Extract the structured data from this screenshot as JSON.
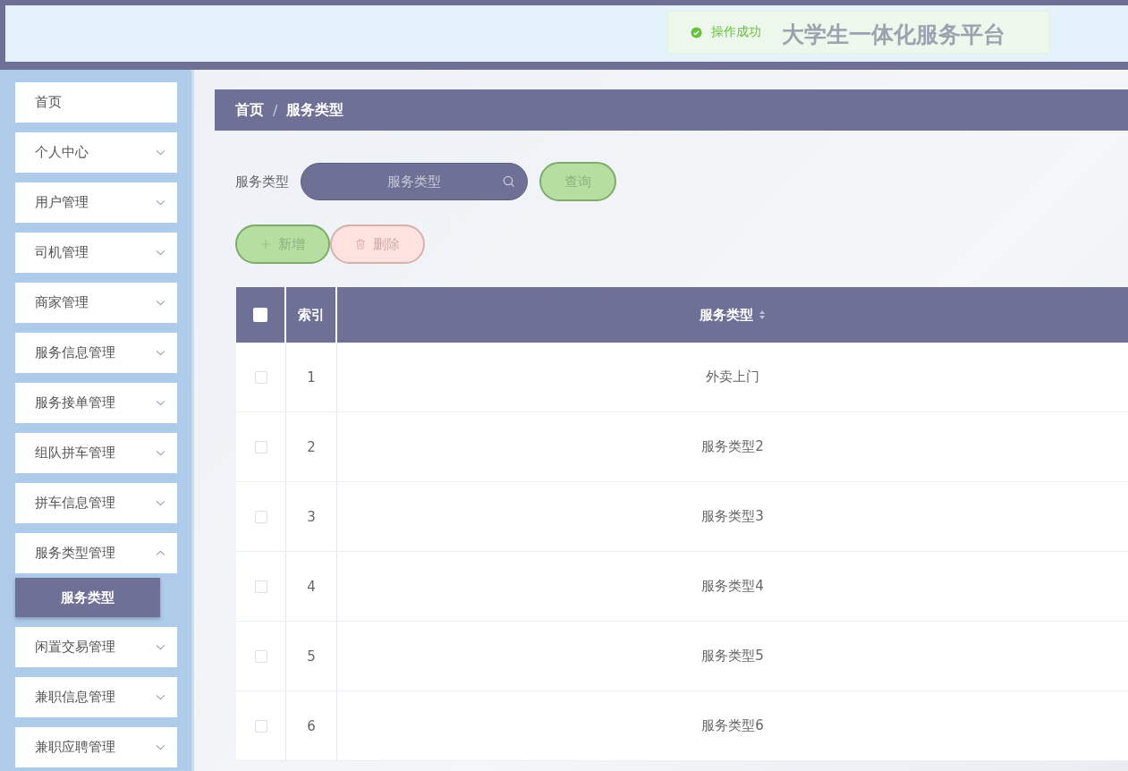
{
  "header": {
    "title": "大学生一体化服务平台",
    "toast": {
      "kind": "success",
      "message": "操作成功"
    }
  },
  "sidebar": {
    "items": [
      {
        "label": "首页",
        "kind": "link",
        "selected": false
      },
      {
        "label": "个人中心",
        "kind": "submenu",
        "expanded": false
      },
      {
        "label": "用户管理",
        "kind": "submenu",
        "expanded": false
      },
      {
        "label": "司机管理",
        "kind": "submenu",
        "expanded": false
      },
      {
        "label": "商家管理",
        "kind": "submenu",
        "expanded": false
      },
      {
        "label": "服务信息管理",
        "kind": "submenu",
        "expanded": false
      },
      {
        "label": "服务接单管理",
        "kind": "submenu",
        "expanded": false
      },
      {
        "label": "组队拼车管理",
        "kind": "submenu",
        "expanded": false
      },
      {
        "label": "拼车信息管理",
        "kind": "submenu",
        "expanded": false
      },
      {
        "label": "服务类型管理",
        "kind": "submenu",
        "expanded": true,
        "children": [
          {
            "label": "服务类型",
            "selected": true
          }
        ]
      },
      {
        "label": "闲置交易管理",
        "kind": "submenu",
        "expanded": false
      },
      {
        "label": "兼职信息管理",
        "kind": "submenu",
        "expanded": false
      },
      {
        "label": "兼职应聘管理",
        "kind": "submenu",
        "expanded": false
      }
    ]
  },
  "breadcrumb": {
    "items": [
      "首页",
      "服务类型"
    ],
    "separator": "/"
  },
  "search": {
    "label": "服务类型",
    "placeholder": "服务类型",
    "button": "查询"
  },
  "actions": [
    {
      "kind": "add",
      "label": "新增"
    },
    {
      "kind": "delete",
      "label": "删除"
    }
  ],
  "table": {
    "select_all_checked": false,
    "columns": [
      {
        "label": "索引",
        "sortable": false
      },
      {
        "label": "服务类型",
        "sortable": true
      }
    ],
    "rows": [
      {
        "index": "1",
        "type": "外卖上门",
        "checked": false
      },
      {
        "index": "2",
        "type": "服务类型2",
        "checked": false
      },
      {
        "index": "3",
        "type": "服务类型3",
        "checked": false
      },
      {
        "index": "4",
        "type": "服务类型4",
        "checked": false
      },
      {
        "index": "5",
        "type": "服务类型5",
        "checked": false
      },
      {
        "index": "6",
        "type": "服务类型6",
        "checked": false
      }
    ]
  }
}
